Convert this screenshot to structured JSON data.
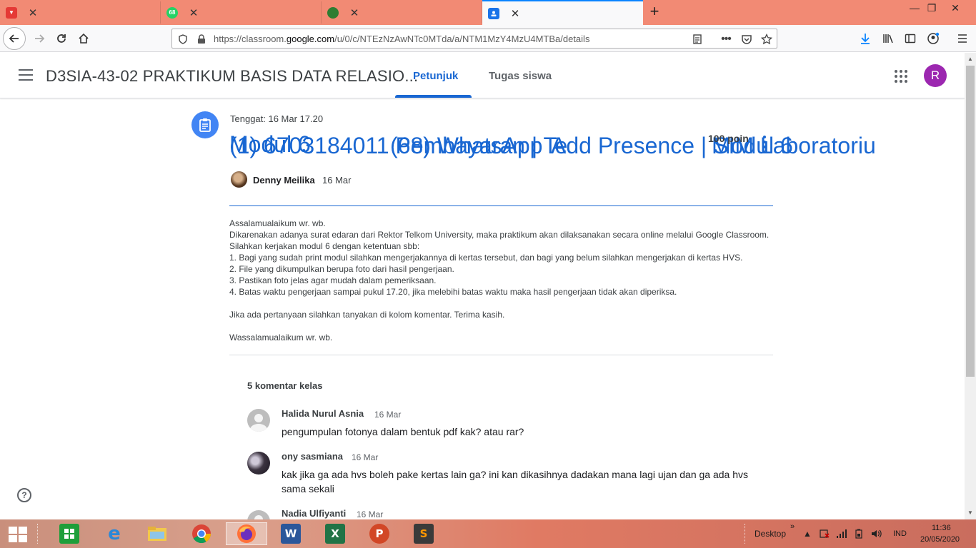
{
  "browser": {
    "tabs": [
      {
        "label": "(1) 6703184011 Pembayaran | Te",
        "icon": "telkom-icon"
      },
      {
        "label": "(68) WhatsApp",
        "icon": "whatsapp-icon",
        "badge": "68"
      },
      {
        "label": "Add Presence | SIM Laboratoriu",
        "icon": "sim-lab-icon"
      },
      {
        "label": "Modul 6",
        "icon": "classroom-icon",
        "active": true
      }
    ],
    "url_prefix": "https://classroom.",
    "url_domain": "google.com",
    "url_suffix": "/u/0/c/NTEzNzAwNTc0MTda/a/NTM1MzY4MzU4MTBa/details"
  },
  "classroom": {
    "class_name": "D3SIA-43-02 PRAKTIKUM BASIS DATA RELASIO...",
    "tabs": [
      "Petunjuk",
      "Tugas siswa"
    ],
    "active_tab": "Petunjuk",
    "avatar_letter": "R"
  },
  "assignment": {
    "due": "Tenggat: 16 Mar 17.20",
    "title": "Modul 6",
    "points": "100 poin",
    "author": "Denny Meilika",
    "date": "16 Mar",
    "body": [
      "Assalamualaikum wr. wb.",
      "Dikarenakan adanya surat edaran dari Rektor Telkom University, maka praktikum akan dilaksanakan secara online melalui Google Classroom. Silahkan kerjakan modul 6 dengan ketentuan sbb:",
      "1. Bagi yang sudah print modul silahkan mengerjakannya di kertas tersebut, dan bagi yang belum silahkan mengerjakan di kertas HVS.",
      "2. File yang dikumpulkan berupa foto dari hasil pengerjaan.",
      "3. Pastikan foto jelas agar mudah dalam pemeriksaan.",
      "4. Batas waktu pengerjaan sampai pukul 17.20, jika melebihi batas waktu maka hasil pengerjaan tidak akan diperiksa.",
      "",
      "Jika ada pertanyaan silahkan tanyakan di kolom komentar. Terima kasih.",
      "",
      "Wassalamualaikum wr. wb."
    ]
  },
  "comments": {
    "header": "5 komentar kelas",
    "items": [
      {
        "name": "Halida Nurul Asnia",
        "date": "16 Mar",
        "text": "pengumpulan fotonya dalam bentuk pdf kak? atau rar?"
      },
      {
        "name": "ony sasmiana",
        "date": "16 Mar",
        "text": "kak jika ga ada hvs boleh pake kertas lain ga? ini kan dikasihnya dadakan mana lagi ujan dan ga ada hvs sama sekali"
      },
      {
        "name": "Nadia Ulfiyanti",
        "date": "16 Mar",
        "text": ""
      }
    ]
  },
  "help_label": "?",
  "taskbar": {
    "apps": [
      "store-icon",
      "internet-explorer-icon",
      "file-explorer-icon",
      "chrome-icon",
      "firefox-icon",
      "word-icon",
      "excel-icon",
      "powerpoint-icon",
      "sublime-text-icon"
    ],
    "app_letters": {
      "word": "W",
      "excel": "X",
      "powerpoint": "P",
      "sublime": "S"
    },
    "desktop_label": "Desktop",
    "chevron": "»",
    "language": "IND",
    "time": "11:36",
    "date": "20/05/2020"
  },
  "colors": {
    "tab_strip": "#f28a74",
    "classroom_blue": "#1967d2",
    "avatar_purple": "#9c27b0",
    "assignment_icon": "#4285f4"
  }
}
